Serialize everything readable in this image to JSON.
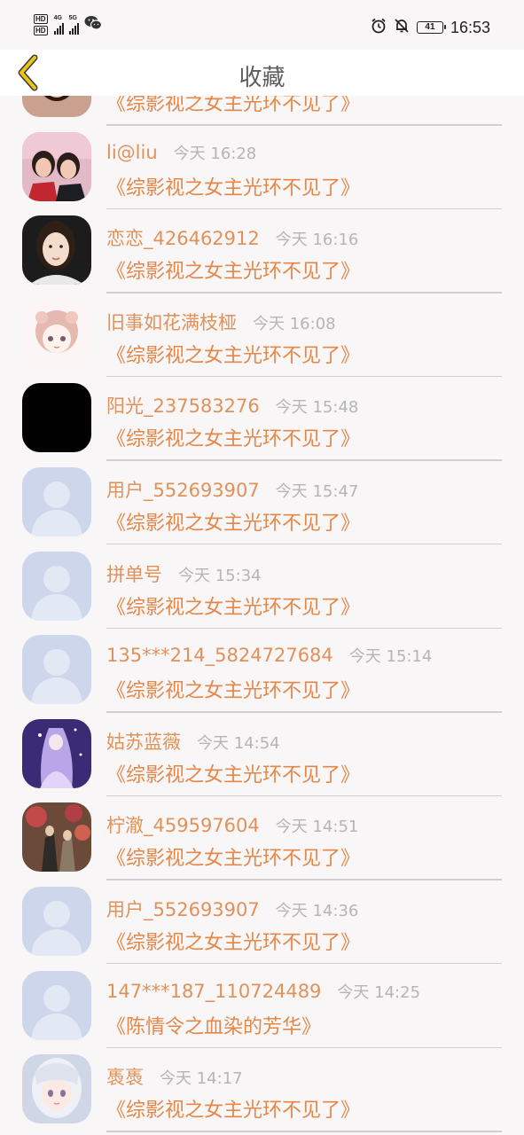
{
  "status_bar": {
    "time": "16:53",
    "battery_level": "41",
    "hd1": "HD",
    "hd2": "HD",
    "net1": "4G",
    "net2": "5G",
    "icons": [
      "hd-icon",
      "signal-icon",
      "wechat-icon",
      "alarm-icon",
      "bell-muted-icon",
      "battery-icon"
    ]
  },
  "header": {
    "title": "收藏",
    "back_icon": "chevron-left-icon"
  },
  "colors": {
    "accent_orange": "#e4884a",
    "username_orange": "#e0925a",
    "timestamp_gray": "#b5b5b5",
    "title_gray": "#5c5c5c",
    "back_icon_yellow": "#e8c417"
  },
  "favorites": [
    {
      "username": "",
      "time": "",
      "title": "《综影视之女主光环不见了》",
      "avatar": "photo-girl-1"
    },
    {
      "username": "li@liu",
      "time": "今天 16:28",
      "title": "《综影视之女主光环不见了》",
      "avatar": "photo-two-girls"
    },
    {
      "username": "恋恋_426462912",
      "time": "今天 16:16",
      "title": "《综影视之女主光环不见了》",
      "avatar": "photo-girl-2"
    },
    {
      "username": "旧事如花满枝桠",
      "time": "今天 16:08",
      "title": "《综影视之女主光环不见了》",
      "avatar": "anime-girl-sketch"
    },
    {
      "username": "阳光_237583276",
      "time": "今天 15:48",
      "title": "《综影视之女主光环不见了》",
      "avatar": "black-square"
    },
    {
      "username": "用户_552693907",
      "time": "今天 15:47",
      "title": "《综影视之女主光环不见了》",
      "avatar": "default-user"
    },
    {
      "username": "拼单号",
      "time": "今天 15:34",
      "title": "《综影视之女主光环不见了》",
      "avatar": "default-user"
    },
    {
      "username": "135***214_5824727684",
      "time": "今天 15:14",
      "title": "《综影视之女主光环不见了》",
      "avatar": "default-user"
    },
    {
      "username": "姑苏蓝薇",
      "time": "今天 14:54",
      "title": "《综影视之女主光环不见了》",
      "avatar": "anime-purple"
    },
    {
      "username": "柠澈_459597604",
      "time": "今天 14:51",
      "title": "《综影视之女主光环不见了》",
      "avatar": "illustration-autumn"
    },
    {
      "username": "用户_552693907",
      "time": "今天 14:36",
      "title": "《综影视之女主光环不见了》",
      "avatar": "default-user"
    },
    {
      "username": "147***187_110724489",
      "time": "今天 14:25",
      "title": "《陈情令之血染的芳华》",
      "avatar": "default-user"
    },
    {
      "username": "褭褭",
      "time": "今天 14:17",
      "title": "《综影视之女主光环不见了》",
      "avatar": "anime-silver-hair"
    }
  ]
}
